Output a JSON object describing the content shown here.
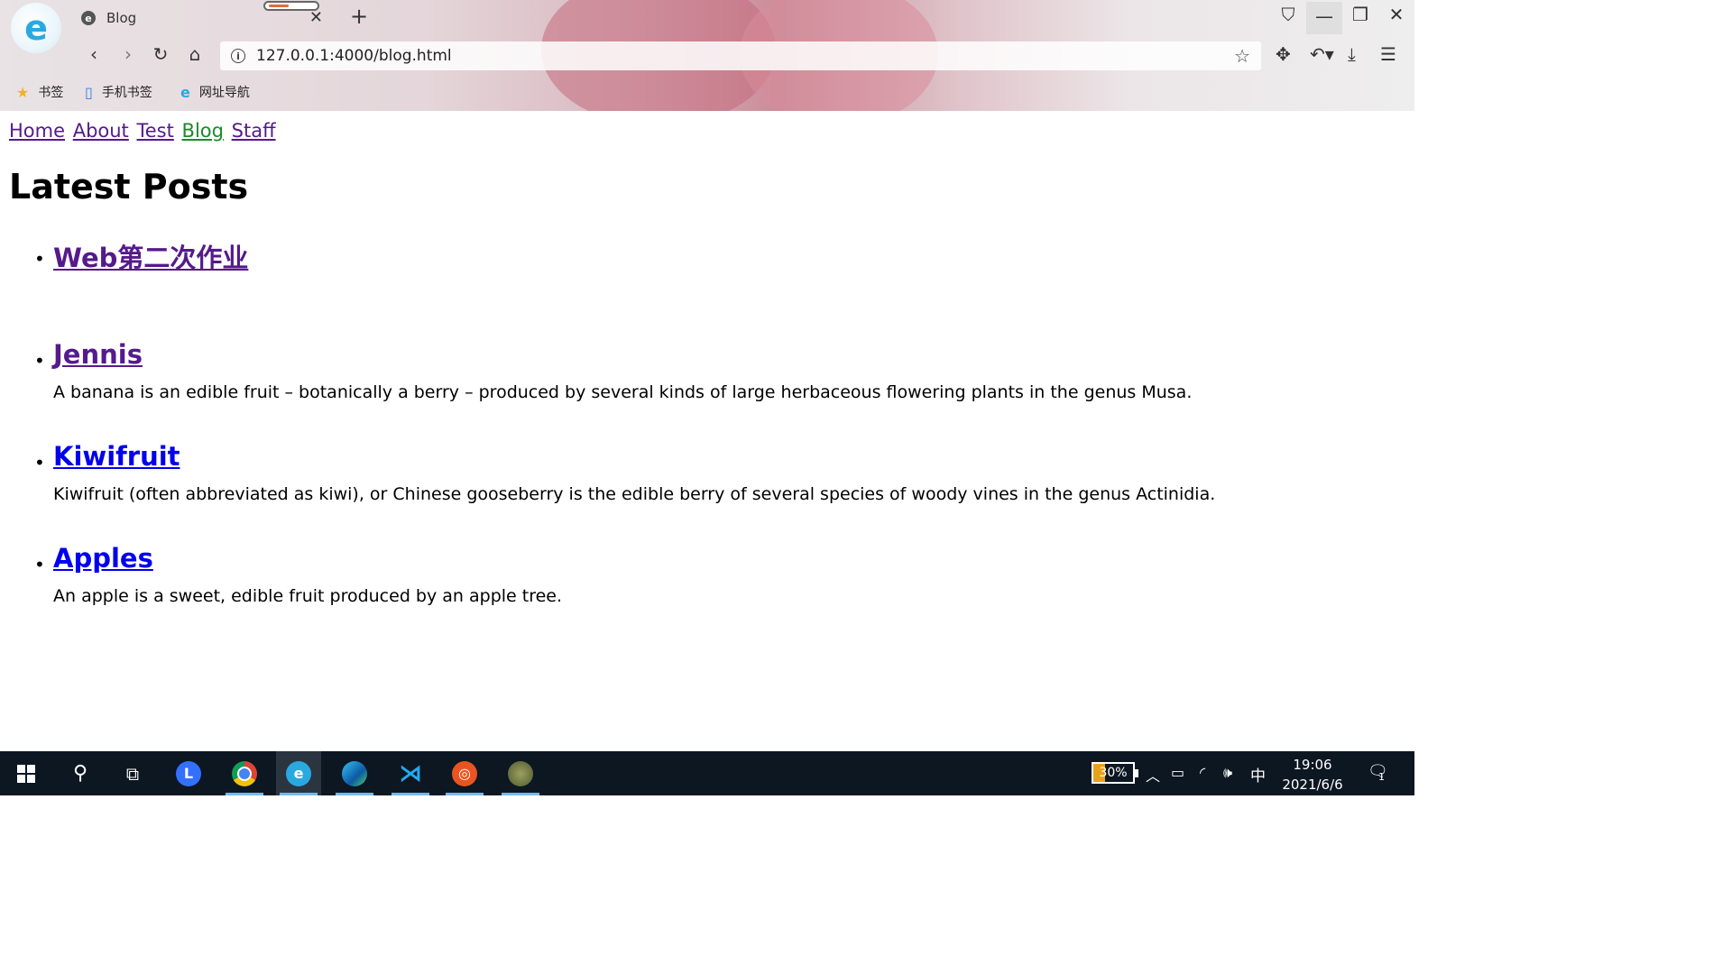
{
  "browser": {
    "logo_letter": "e",
    "tab": {
      "icon": "e",
      "title": "Blog"
    },
    "url": "127.0.0.1:4000/blog.html",
    "bookmarks": [
      {
        "label": "书签",
        "icon": "star-icon"
      },
      {
        "label": "手机书签",
        "icon": "phone-icon"
      },
      {
        "label": "网址导航",
        "icon": "browser-e-icon"
      }
    ]
  },
  "site_nav": [
    "Home",
    "About",
    "Test",
    "Blog",
    "Staff"
  ],
  "page": {
    "heading": "Latest Posts",
    "posts": [
      {
        "title": "Web第二次作业",
        "excerpt": ""
      },
      {
        "title": "Jennis",
        "excerpt": "A banana is an edible fruit – botanically a berry – produced by several kinds of large herbaceous flowering plants in the genus Musa."
      },
      {
        "title": "Kiwifruit",
        "excerpt": "Kiwifruit (often abbreviated as kiwi), or Chinese gooseberry is the edible berry of several species of woody vines in the genus Actinidia."
      },
      {
        "title": "Apples",
        "excerpt": "An apple is a sweet, edible fruit produced by an apple tree."
      }
    ]
  },
  "taskbar": {
    "battery": "30%",
    "ime": "中",
    "time": "19:06",
    "date": "2021/6/6",
    "notifications": "1"
  },
  "colors": {
    "visited_link": "#551a8b",
    "active_nav": "#1a8a2a",
    "unvisited_link": "#0000ee",
    "taskbar": "#0c1722"
  }
}
